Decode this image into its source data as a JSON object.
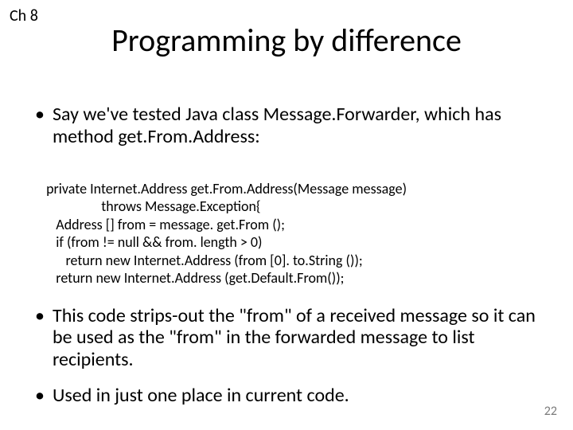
{
  "chapter": "Ch 8",
  "title": "Programming by difference",
  "bullets_top": [
    "Say we've tested Java class Message.Forwarder, which has method get.From.Address:"
  ],
  "code_lines": [
    " private Internet.Address get.From.Address(Message message)",
    "                  throws Message.Exception{",
    "    Address [] from = message. get.From ();",
    "    if (from != null && from. length > 0)",
    "       return new Internet.Address (from [0]. to.String ());",
    "    return new Internet.Address (get.Default.From());"
  ],
  "bullets_bottom": [
    "This code strips-out the \"from\" of a received message so it can be used as the \"from\" in the forwarded message to list recipients.",
    "Used in just one place in current code."
  ],
  "page_number": "22"
}
